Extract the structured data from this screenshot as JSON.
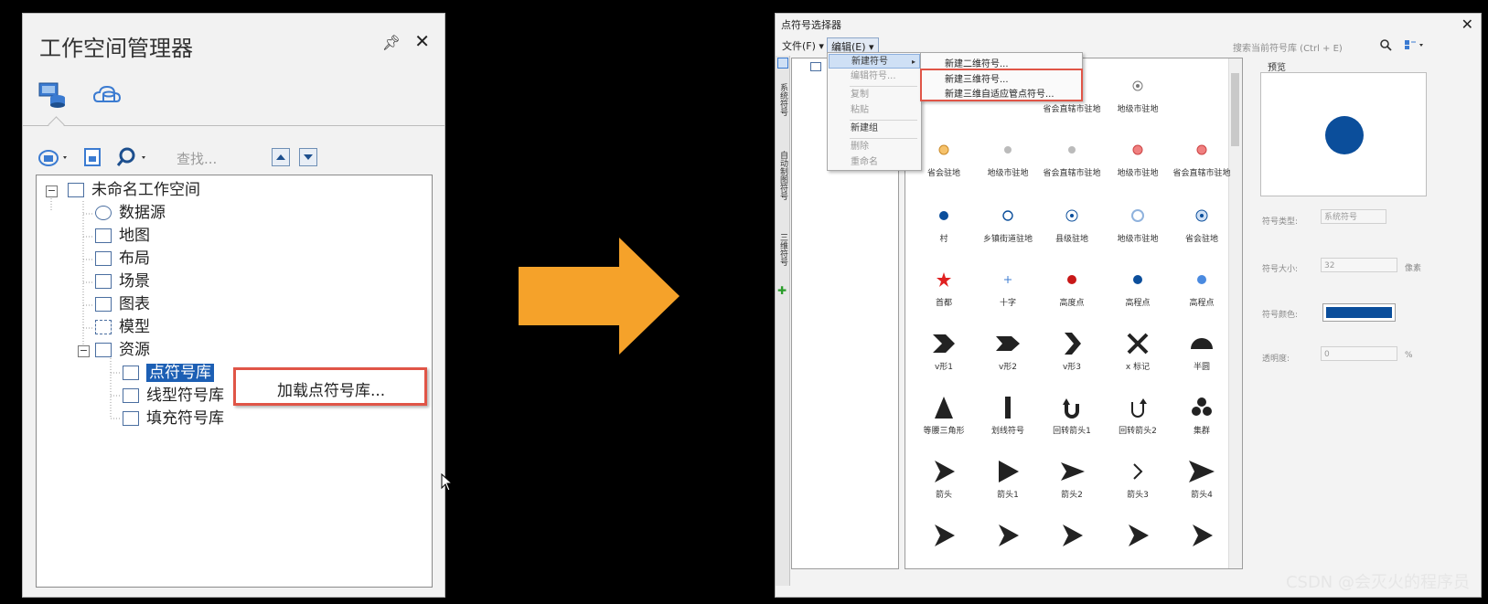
{
  "workspace_manager": {
    "title": "工作空间管理器",
    "search_placeholder": "查找...",
    "tree": {
      "root": "未命名工作空间",
      "items": [
        "数据源",
        "地图",
        "布局",
        "场景",
        "图表",
        "模型",
        "资源"
      ],
      "resources": [
        "点符号库",
        "线型符号库",
        "填充符号库"
      ]
    },
    "context_menu": {
      "item": "加载点符号库..."
    }
  },
  "symbol_selector": {
    "title": "点符号选择器",
    "menus": {
      "file": "文件(F)",
      "edit": "编辑(E)"
    },
    "search_placeholder": "搜索当前符号库 (Ctrl + E)",
    "edit_menu": {
      "items": [
        "新建符号",
        "编辑符号...",
        "复制",
        "粘贴",
        "新建组",
        "删除",
        "重命名"
      ]
    },
    "new_submenu": {
      "items": [
        "新建二维符号...",
        "新建三维符号...",
        "新建三维自适应管点符号..."
      ]
    },
    "side_tabs": [
      "系统符号",
      "自动制图符号",
      "三维符号"
    ],
    "grid": {
      "rows": [
        [
          "",
          "",
          "省会直辖市驻地",
          "地级市驻地",
          ""
        ],
        [
          "省会驻地",
          "地级市驻地",
          "省会直辖市驻地",
          "地级市驻地",
          "省会直辖市驻地"
        ],
        [
          "村",
          "乡镇街道驻地",
          "县级驻地",
          "地级市驻地",
          "省会驻地"
        ],
        [
          "首都",
          "十字",
          "高度点",
          "高程点",
          "高程点"
        ],
        [
          "v形1",
          "v形2",
          "v形3",
          "x 标记",
          "半圆"
        ],
        [
          "等腰三角形",
          "划线符号",
          "回转箭头1",
          "回转箭头2",
          "集群"
        ],
        [
          "箭头",
          "箭头1",
          "箭头2",
          "箭头3",
          "箭头4"
        ]
      ]
    },
    "preview": {
      "label": "预览",
      "symbol_type_label": "符号类型:",
      "symbol_type_value": "系统符号",
      "size_label": "符号大小:",
      "size_value": "32",
      "size_unit": "像素",
      "color_label": "符号颜色:",
      "transparency_label": "透明度:",
      "transparency_value": "0",
      "transparency_unit": "%"
    }
  },
  "watermark": "CSDN @会灭火的程序员",
  "colors": {
    "arrow": "#f5a22a",
    "highlight_red": "#e05547",
    "symbol_blue": "#0b4e9b",
    "selection": "#1c5fb4"
  }
}
